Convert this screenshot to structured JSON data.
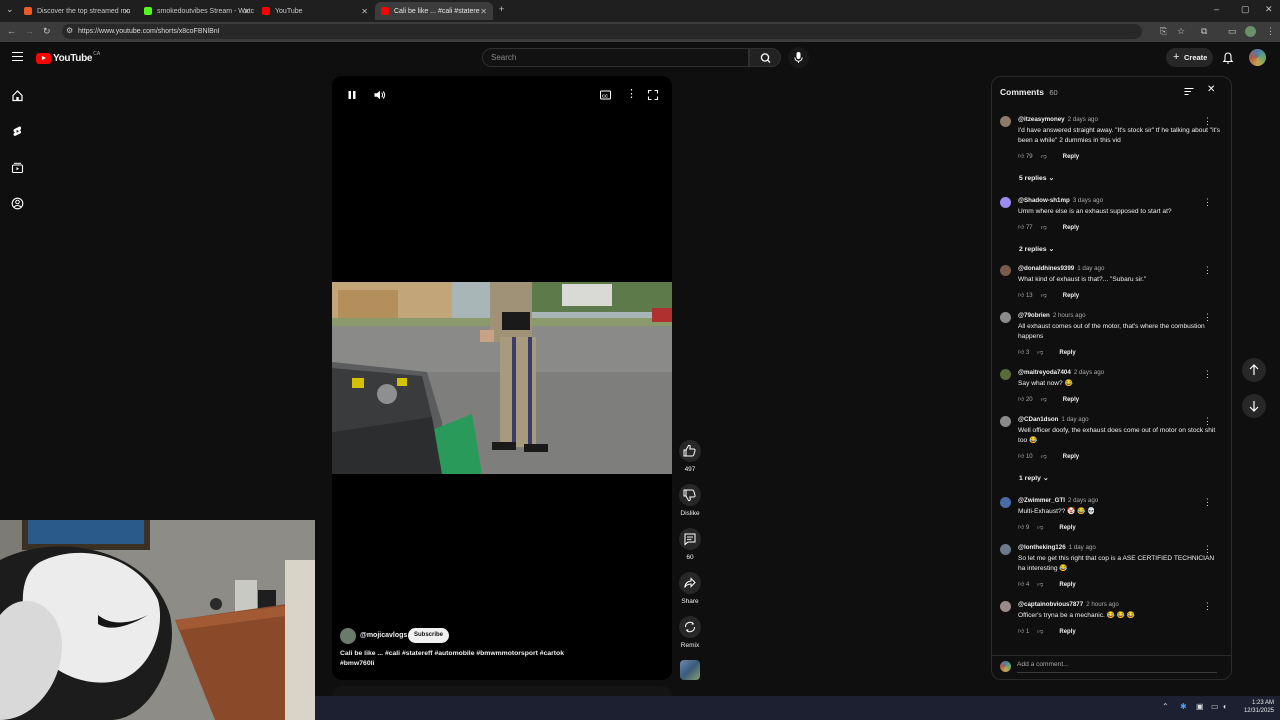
{
  "browser": {
    "tabs": [
      {
        "label": "Discover the top streamed mu",
        "active": false,
        "favicon_color": "#ef5a24"
      },
      {
        "label": "smokedoutvibes Stream - Watc",
        "active": false,
        "favicon_color": "#53fc18"
      },
      {
        "label": "YouTube",
        "active": false,
        "favicon_color": "#ff0000"
      },
      {
        "label": "Cali be like ... #cali #statere",
        "active": true,
        "favicon_color": "#ff0000"
      }
    ],
    "url": "https://www.youtube.com/shorts/x8coFBNlBnI"
  },
  "header": {
    "logo_text": "YouTube",
    "region": "CA",
    "search_placeholder": "Search",
    "create_label": "Create"
  },
  "short": {
    "channel": "@mojicavlogs",
    "subscribe_label": "Subscribe",
    "title_line1": "Cali be like ... #cali #statereff #automobile #bmwmmotorsport #cartok",
    "title_line2": "#bmw760li"
  },
  "actions": {
    "likes": "497",
    "dislike_label": "Dislike",
    "comments_count": "60",
    "share_label": "Share",
    "remix_label": "Remix"
  },
  "comments_panel": {
    "title": "Comments",
    "count": "60",
    "add_placeholder": "Add a comment...",
    "reply_label": "Reply",
    "items": [
      {
        "handle": "@itzeasymoney",
        "time": "2 days ago",
        "text": "I'd have answered straight away. \"It's stock sir\"  tf he talking about \"it's been a while\" 2 dummies in this vid",
        "likes": "79",
        "replies": "5 replies",
        "avatar_color": "#8b7b68"
      },
      {
        "handle": "@Shadow-sh1mp",
        "time": "3 days ago",
        "text": "Umm where else is an exhaust supposed to start at?",
        "likes": "77",
        "replies": "2 replies",
        "avatar_color": "#9c8cf0"
      },
      {
        "handle": "@donaldhines9399",
        "time": "1 day ago",
        "text": "What kind of exhaust is that?... \"Subaru sir.\"",
        "likes": "13",
        "replies": "",
        "avatar_color": "#7a5a4a"
      },
      {
        "handle": "@79obrien",
        "time": "2 hours ago",
        "text": "All exhaust comes out of the motor, that's where the combustion happens",
        "likes": "3",
        "replies": "",
        "avatar_color": "#8a8a8a"
      },
      {
        "handle": "@maitreyoda7404",
        "time": "2 days ago",
        "text": "Say what now? 😂",
        "likes": "20",
        "replies": "",
        "avatar_color": "#5a6a3a"
      },
      {
        "handle": "@CDan1dson",
        "time": "1 day ago",
        "text": "Well officer doofy, the exhaust does come out of motor on stock shit too 😂",
        "likes": "10",
        "replies": "1 reply",
        "avatar_color": "#8a8a8a"
      },
      {
        "handle": "@Zwimmer_GTI",
        "time": "2 days ago",
        "text": "Multi-Exhaust?? 🤡 😂 💀",
        "likes": "9",
        "replies": "",
        "avatar_color": "#4a6aa8"
      },
      {
        "handle": "@lontheking126",
        "time": "1 day ago",
        "text": "So let me get this right that cop is a ASE CERTIFIED TECHNICIAN ha interesting 😂",
        "likes": "4",
        "replies": "",
        "avatar_color": "#6a7a8a"
      },
      {
        "handle": "@captainobvious7877",
        "time": "2 hours ago",
        "text": "Officer's tryna be a mechanic. 😂 😂 😂",
        "likes": "1",
        "replies": "",
        "avatar_color": "#9a8a8a"
      }
    ]
  },
  "taskbar": {
    "time": "1:23 AM",
    "date": "12/31/2025"
  }
}
